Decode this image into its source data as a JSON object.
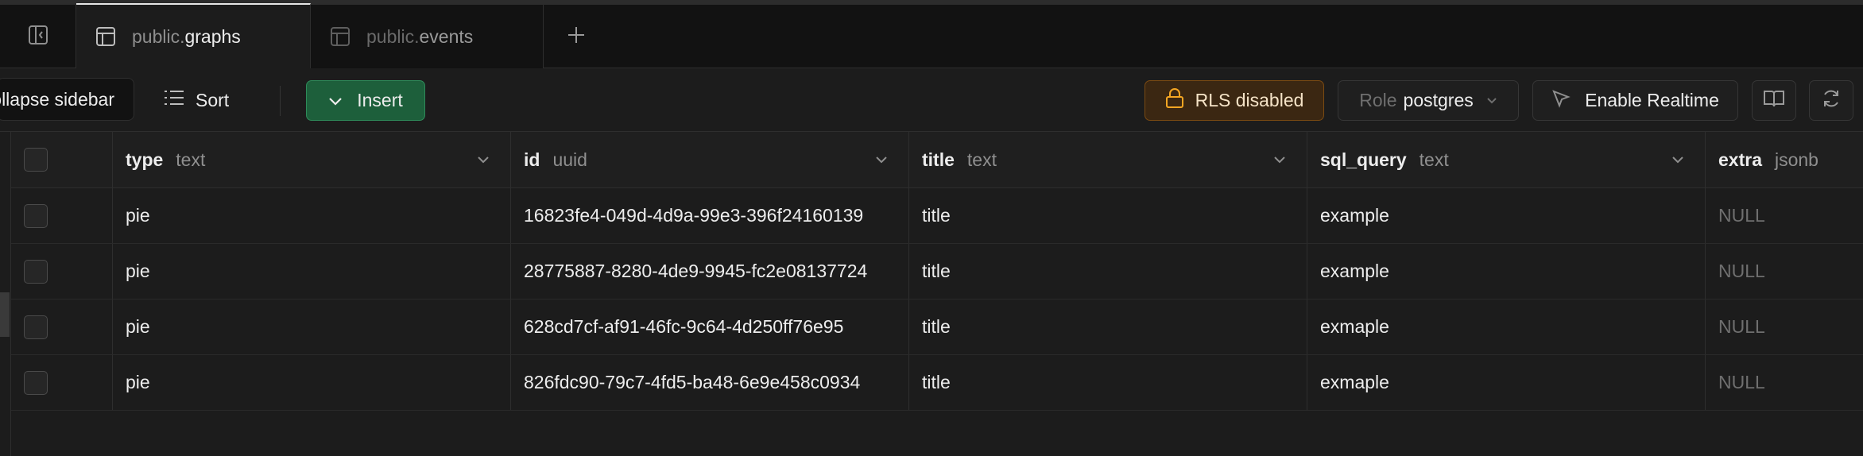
{
  "tabs": [
    {
      "schema": "public.",
      "name": "graphs",
      "active": true
    },
    {
      "schema": "public.",
      "name": "events",
      "active": false
    }
  ],
  "toolbar": {
    "tooltip": "Collapse sidebar",
    "sort_label": "Sort",
    "insert_label": "Insert",
    "rls_label": "RLS disabled",
    "role_label": "Role",
    "role_value": "postgres",
    "realtime_label": "Enable Realtime"
  },
  "table": {
    "columns": [
      {
        "name": "type",
        "type": "text"
      },
      {
        "name": "id",
        "type": "uuid"
      },
      {
        "name": "title",
        "type": "text"
      },
      {
        "name": "sql_query",
        "type": "text"
      },
      {
        "name": "extra",
        "type": "jsonb"
      }
    ],
    "rows": [
      {
        "type": "pie",
        "id": "16823fe4-049d-4d9a-99e3-396f24160139",
        "title": "title",
        "sql_query": "example",
        "extra": "NULL"
      },
      {
        "type": "pie",
        "id": "28775887-8280-4de9-9945-fc2e08137724",
        "title": "title",
        "sql_query": "example",
        "extra": "NULL"
      },
      {
        "type": "pie",
        "id": "628cd7cf-af91-46fc-9c64-4d250ff76e95",
        "title": "title",
        "sql_query": "exmaple",
        "extra": "NULL"
      },
      {
        "type": "pie",
        "id": "826fdc90-79c7-4fd5-ba48-6e9e458c0934",
        "title": "title",
        "sql_query": "exmaple",
        "extra": "NULL"
      }
    ]
  },
  "colors": {
    "insert_bg": "#1d5f3b",
    "rls_bg": "#3b2712",
    "rls_icon": "#f5a623"
  },
  "icons": {
    "sidebar_toggle": "sidebar-panel-icon",
    "tab": "table-icon",
    "new_tab": "plus-icon",
    "sort": "list-icon",
    "insert": "chevron-down-icon",
    "rls": "lock-icon",
    "realtime": "cursor-icon",
    "docs": "book-icon",
    "refresh": "refresh-icon"
  }
}
